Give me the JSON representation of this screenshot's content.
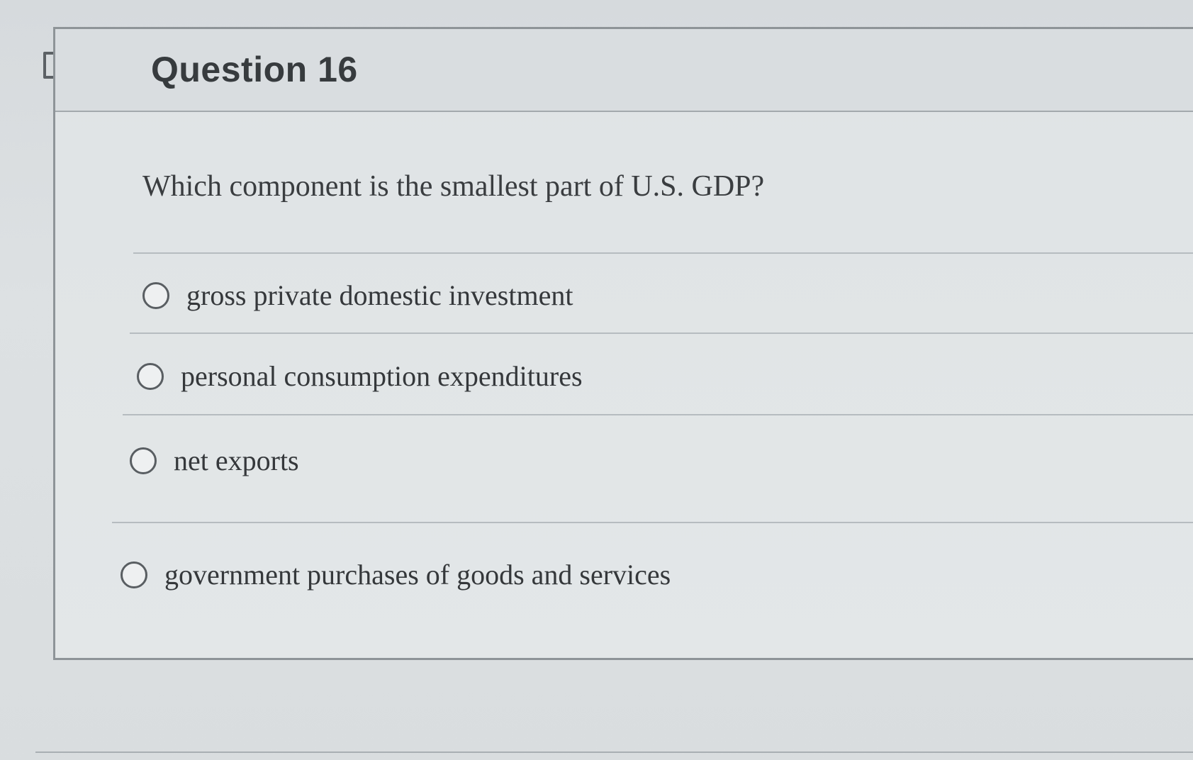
{
  "question": {
    "title": "Question 16",
    "prompt": "Which component is the smallest part of U.S. GDP?",
    "answers": [
      {
        "label": "gross private domestic investment"
      },
      {
        "label": "personal consumption expenditures"
      },
      {
        "label": "net exports"
      },
      {
        "label": "government purchases of goods and services"
      }
    ]
  },
  "colors": {
    "card_border": "#8e9498",
    "text": "#35383b"
  },
  "icons": {
    "flag": "flag-icon",
    "radio": "radio-unselected-icon"
  }
}
